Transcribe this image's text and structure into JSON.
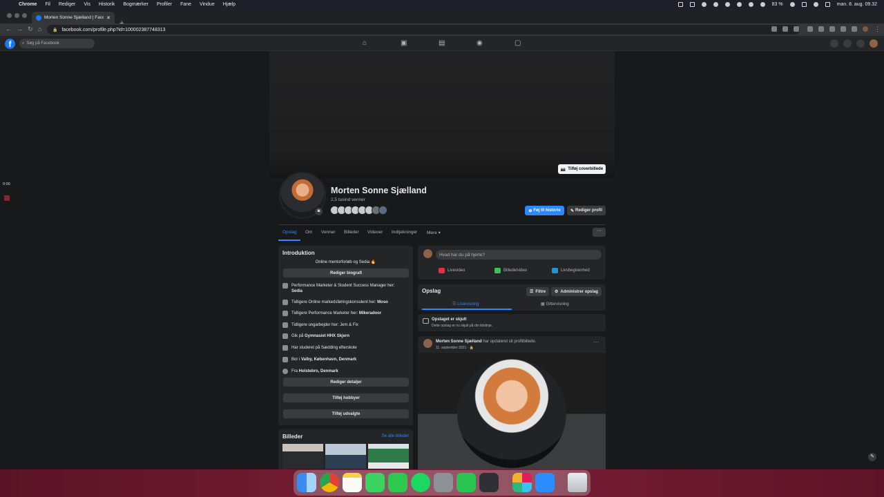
{
  "menubar": {
    "apple": "",
    "items": [
      "Chrome",
      "Fil",
      "Rediger",
      "Vis",
      "Historik",
      "Bogmærker",
      "Profiler",
      "Fane",
      "Vindue",
      "Hjælp"
    ],
    "battery": "83 %",
    "clock": "man. 8. aug.  09.32"
  },
  "browser": {
    "tab_title": "Morten Sonne Sjælland | Faceb",
    "url": "facebook.com/profile.php?id=100002387748313"
  },
  "facebook": {
    "logo": "f",
    "search_placeholder": "Søg på Facebook"
  },
  "profile": {
    "add_cover_label": "Tilføj coverbillede",
    "name": "Morten Sonne Sjælland",
    "friends": "2,5 tusind venner",
    "add_story_label": "Føj til historie",
    "edit_profile_label": "Rediger profil",
    "tabs": [
      "Opslag",
      "Om",
      "Venner",
      "Billeder",
      "Videoer",
      "Indtjekninger",
      "Mere"
    ],
    "more_dots": "···"
  },
  "intro": {
    "title": "Introduktion",
    "bio": "Online mentorforløb og Sedia 🔥",
    "edit_bio_label": "Rediger biografi",
    "rows": [
      {
        "pre": "Performance Marketer & Student Success Manager her: ",
        "bold": "Sedia"
      },
      {
        "pre": "Tidligere Online markedsføringskonsulent her: ",
        "bold": "Moso"
      },
      {
        "pre": "Tidligere Performance Marketer her: ",
        "bold": "Mikeradoor"
      },
      {
        "pre": "Tidligere ungarbejder her: Jem & Fix",
        "bold": ""
      },
      {
        "pre": "Gik på ",
        "bold": "Gymnasiet HHX Skjern"
      },
      {
        "pre": "Har studeret på Sædding efterskole",
        "bold": ""
      },
      {
        "pre": "Bor i ",
        "bold": "Valby, København, Denmark"
      },
      {
        "pre": "Fra ",
        "bold": "Holstebro, Denmark"
      }
    ],
    "edit_details_label": "Rediger detaljer",
    "add_hobbies_label": "Tilføj hobbyer",
    "add_featured_label": "Tilføj udvalgte"
  },
  "photos": {
    "title": "Billeder",
    "see_all": "Se alle billeder"
  },
  "composer": {
    "placeholder": "Hvad har du på hjerte?",
    "live_label": "Livevideo",
    "photo_label": "Billede/video",
    "event_label": "Livsbegivenhed"
  },
  "posts": {
    "title": "Opslag",
    "filter_label": "Filtre",
    "manage_label": "Administrer opslag",
    "list_view": "Listevisning",
    "grid_view": "Gittervisning",
    "hidden_title": "Opslaget er skjult",
    "hidden_sub": "Dette opslag er nu skjult på din tidslinje."
  },
  "post": {
    "author": "Morten Sonne Sjælland",
    "action": " har opdateret sit profilbillede.",
    "date": "11. september 2021 · "
  },
  "video": {
    "time": "0:00"
  },
  "colors": {
    "accent": "#2d88ff",
    "fb_blue": "#1877f2",
    "card": "#242526",
    "page_bg": "#18191a"
  }
}
